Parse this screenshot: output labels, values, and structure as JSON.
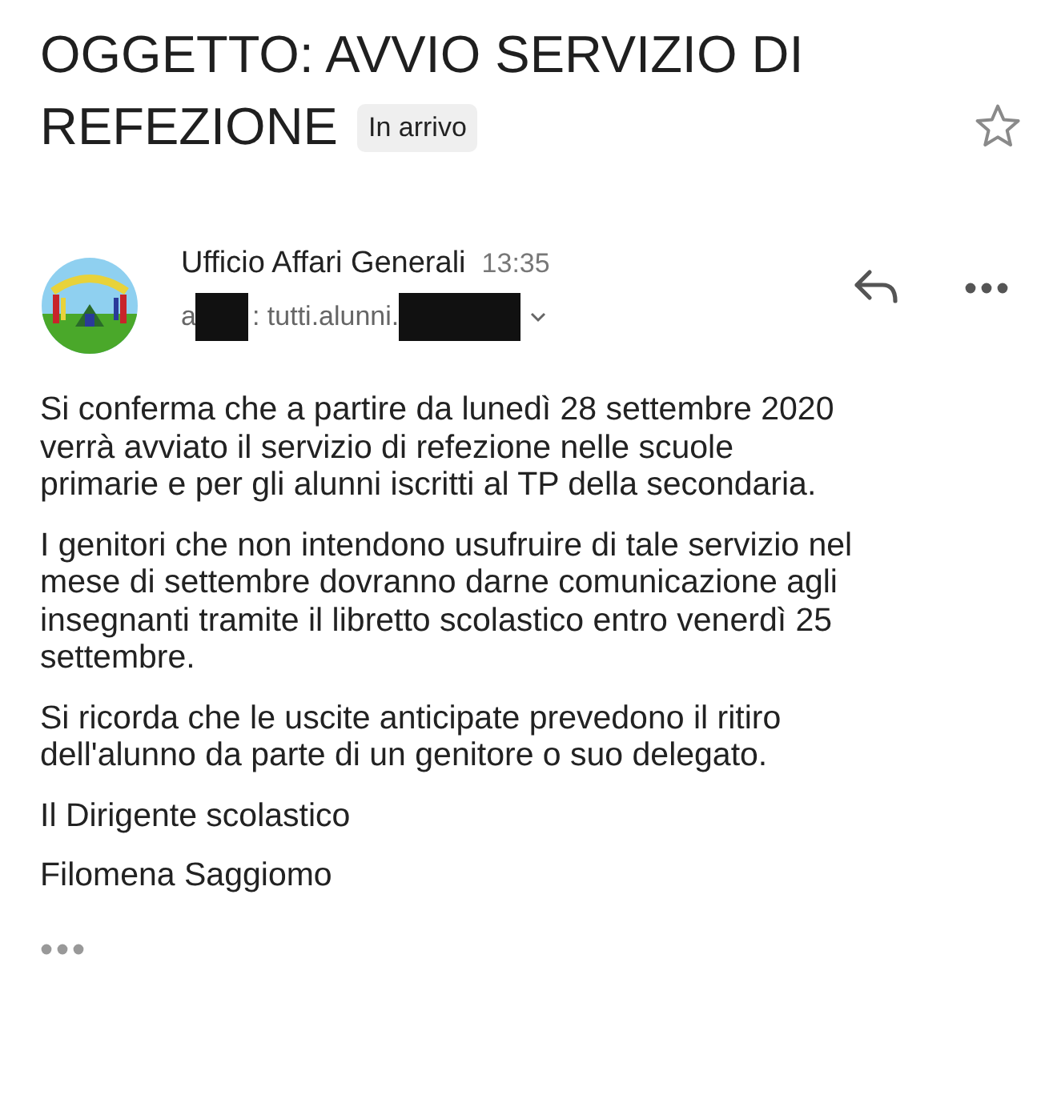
{
  "subject": {
    "lines": [
      "OGGETTO: AVVIO SERVIZIO DI",
      "REFEZIONE"
    ],
    "label": "In arrivo",
    "starred": false
  },
  "sender": {
    "name": "Ufficio Affari Generali",
    "time": "13:35",
    "to_prefix": "a",
    "to_text": ": tutti.alunni."
  },
  "body": [
    {
      "lines": [
        "Si conferma che a partire da lunedì 28 settembre 2020",
        "verrà avviato il servizio di refezione nelle scuole",
        "primarie e per gli alunni iscritti al TP della secondaria."
      ]
    },
    {
      "lines": [
        "I genitori che non intendono usufruire di tale servizio nel",
        "mese di settembre dovranno darne comunicazione agli",
        "insegnanti tramite il libretto scolastico entro venerdì 25",
        "settembre."
      ]
    },
    {
      "lines": [
        "Si ricorda che le uscite anticipate prevedono il ritiro",
        "dell'alunno da parte di un genitore o suo delegato."
      ]
    },
    {
      "lines": [
        "Il Dirigente scolastico"
      ]
    },
    {
      "lines": [
        "Filomena Saggiomo"
      ]
    }
  ]
}
